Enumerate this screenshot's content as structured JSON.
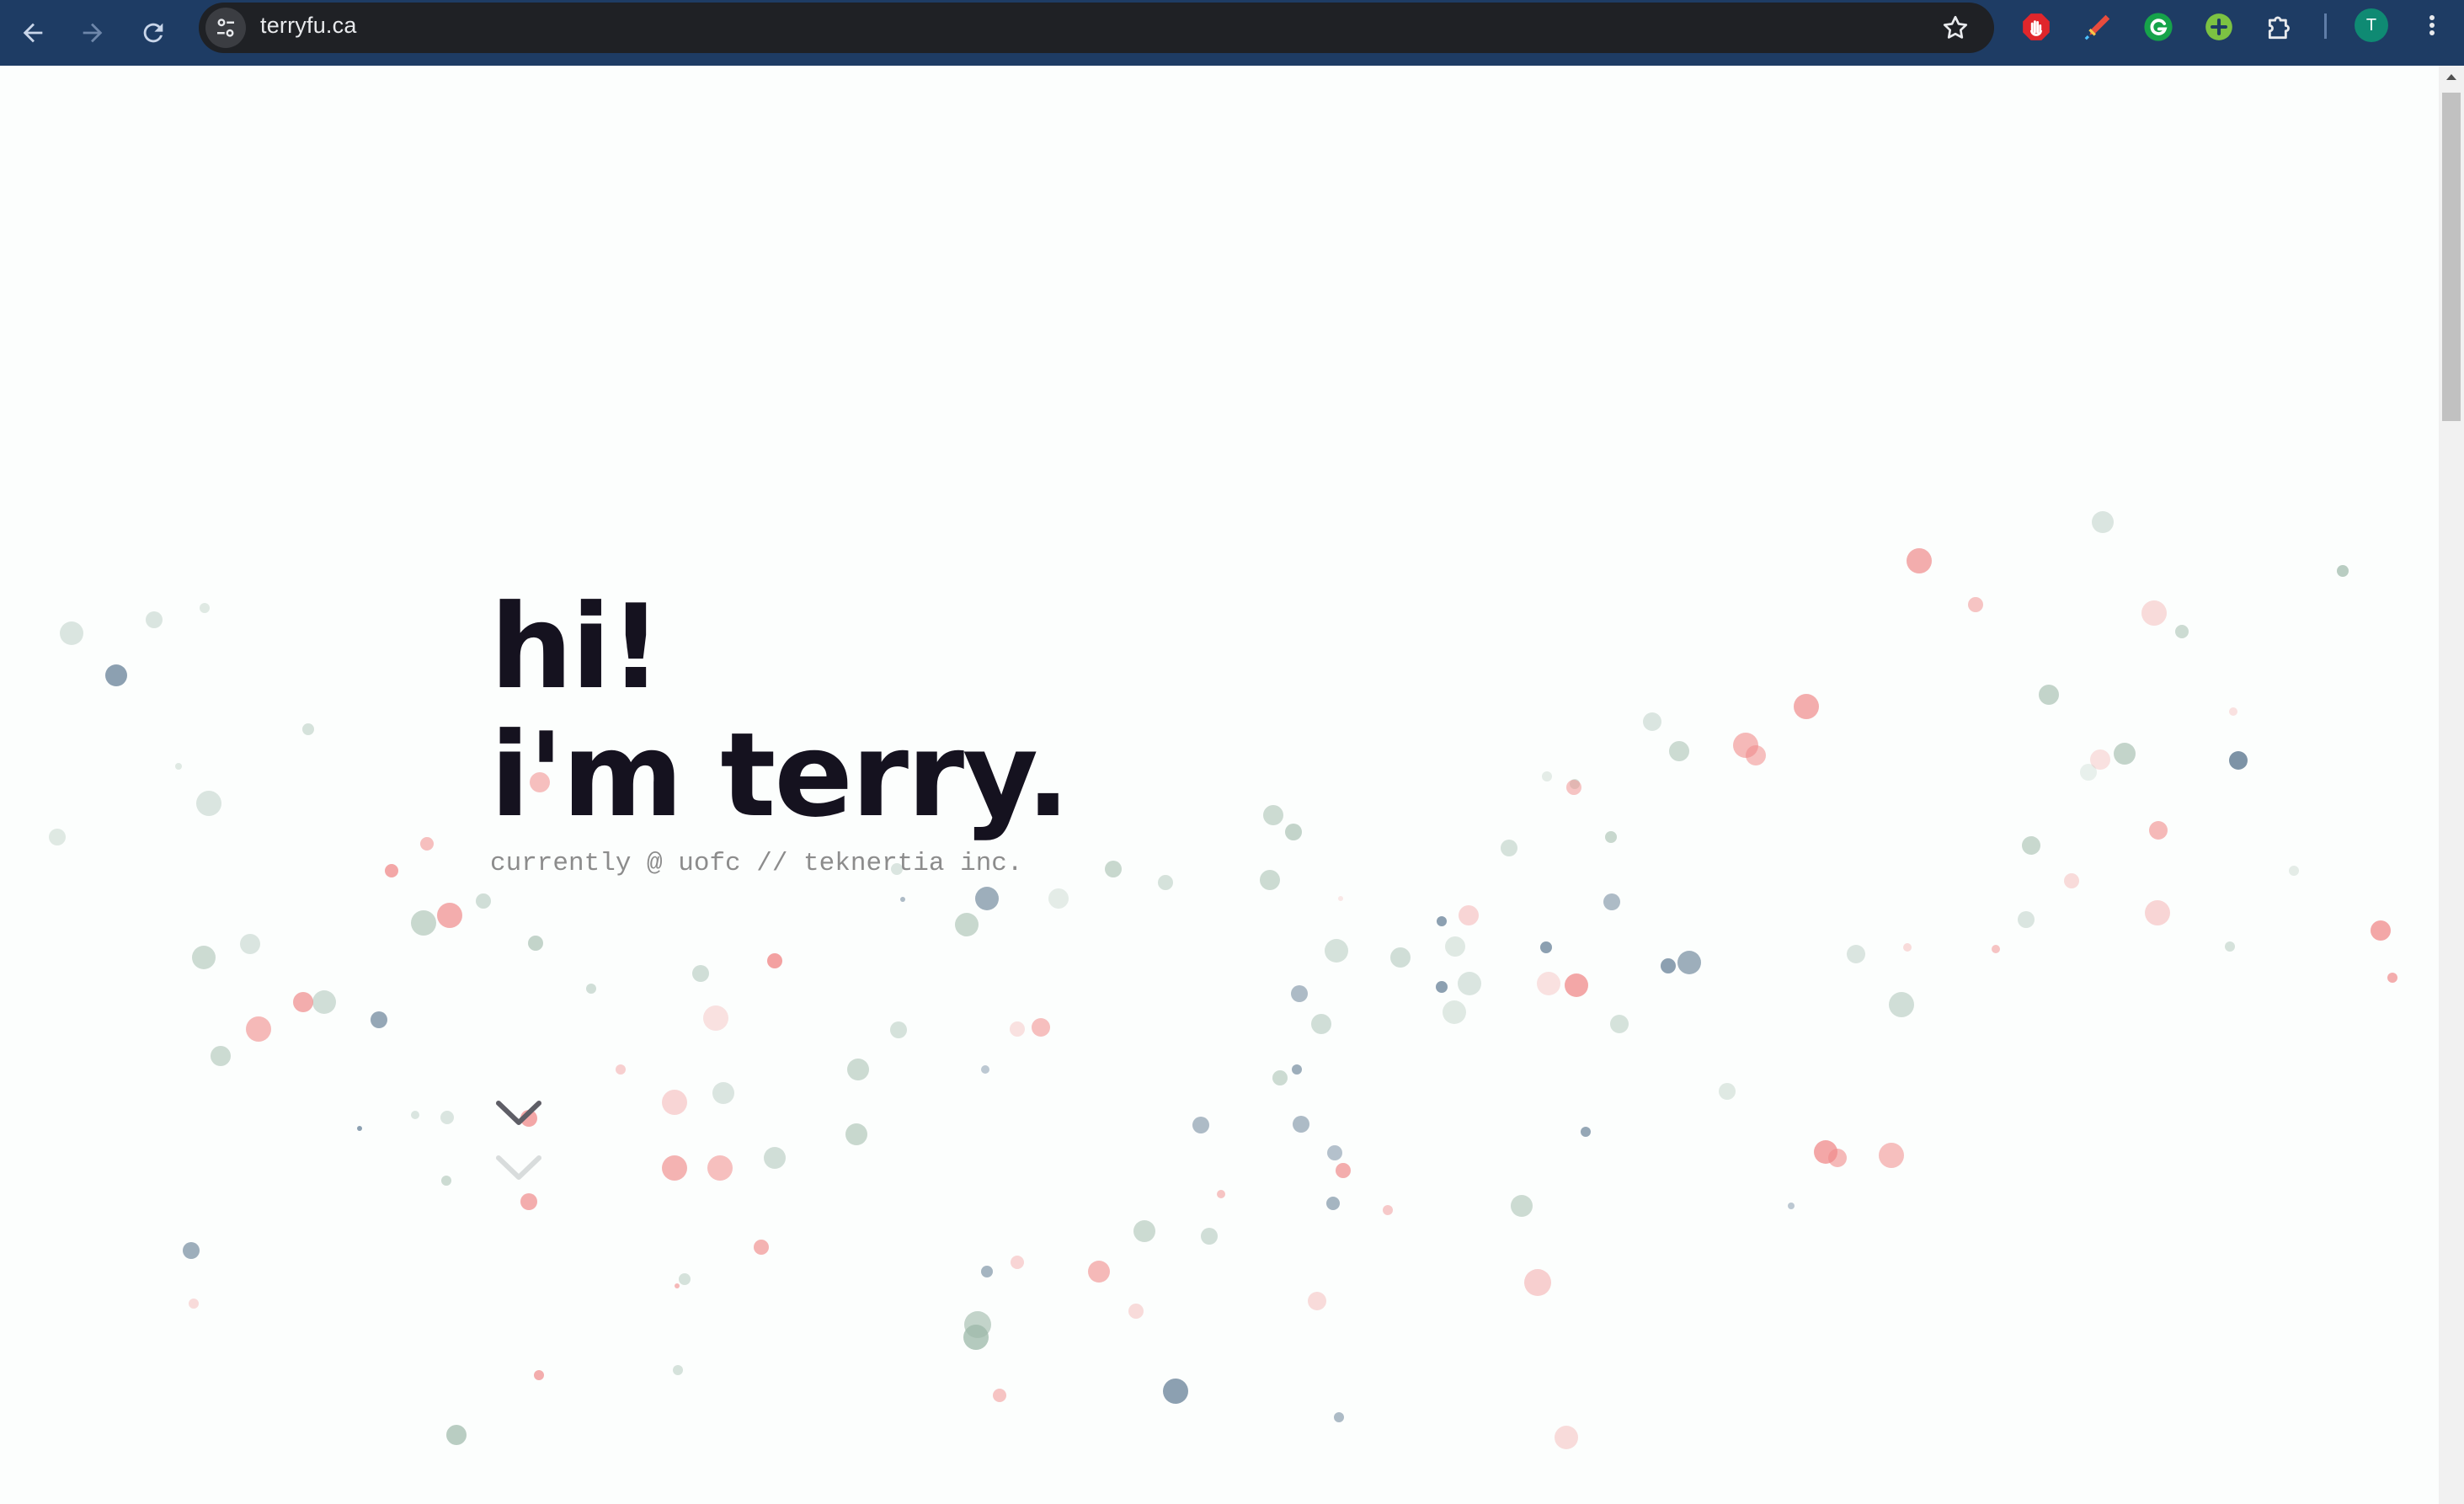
{
  "browser": {
    "url": "terryfu.ca",
    "back_icon": "arrow-left-icon",
    "forward_icon": "arrow-right-icon",
    "reload_icon": "reload-icon",
    "site_info_icon": "tune-icon",
    "bookmark_icon": "star-icon",
    "extensions": [
      "stop-hand-icon",
      "pen-icon",
      "grammarly-icon",
      "plus-circle-icon",
      "puzzle-icon"
    ],
    "profile_initial": "T",
    "menu_icon": "kebab-menu-icon",
    "colors": {
      "toolbar": "#1e3c64",
      "omnibox": "#1f2125",
      "avatar": "#0f8a73"
    }
  },
  "hero": {
    "line1": "hi!",
    "line2": "i'm terry.",
    "subtitle": "currently @ uofc // teknertia inc."
  },
  "scroll_hint": {
    "icon": "chevron-down-icon"
  },
  "colors": {
    "background": "#fcfefd",
    "heading": "#15121f",
    "subtitle": "#8c8c8c",
    "particle_pink": "#f08a8a",
    "particle_sage": "#9cb8a8",
    "particle_slate": "#5d7890"
  }
}
